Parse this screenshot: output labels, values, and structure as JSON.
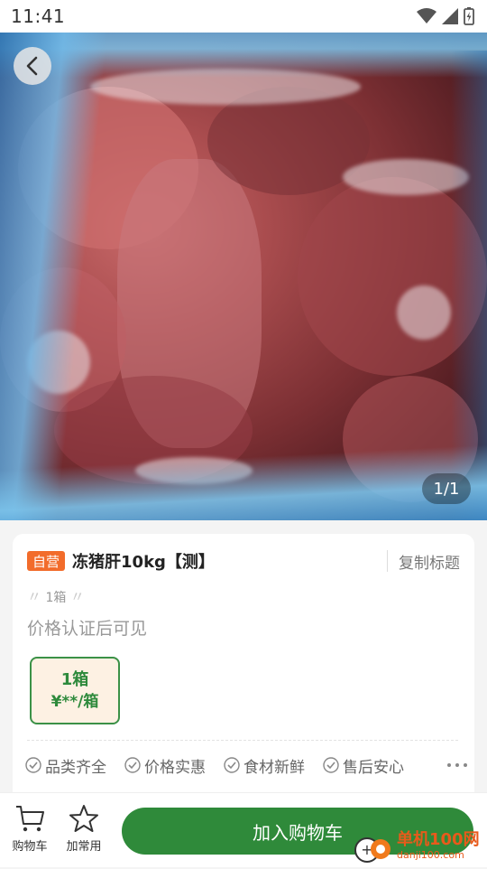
{
  "status_bar": {
    "time": "11:41"
  },
  "gallery": {
    "counter": "1/1"
  },
  "product": {
    "self_badge": "自营",
    "title": "冻猪肝10kg【测】",
    "copy_title_label": "复制标题",
    "spec_tag": "1箱",
    "price_note": "价格认证后可见",
    "spec_option": {
      "unit": "1箱",
      "price": "¥**/箱"
    },
    "guarantees": [
      "品类齐全",
      "价格实惠",
      "食材新鲜",
      "售后安心"
    ]
  },
  "bottom_bar": {
    "cart_label": "购物车",
    "favorite_label": "加常用",
    "add_to_cart_label": "加入购物车"
  },
  "watermark": {
    "main": "单机100网",
    "sub": "danji100.com"
  },
  "colors": {
    "accent_green": "#2f8a3a",
    "badge_orange": "#f26c2b",
    "spec_bg": "#fdf1e3"
  }
}
